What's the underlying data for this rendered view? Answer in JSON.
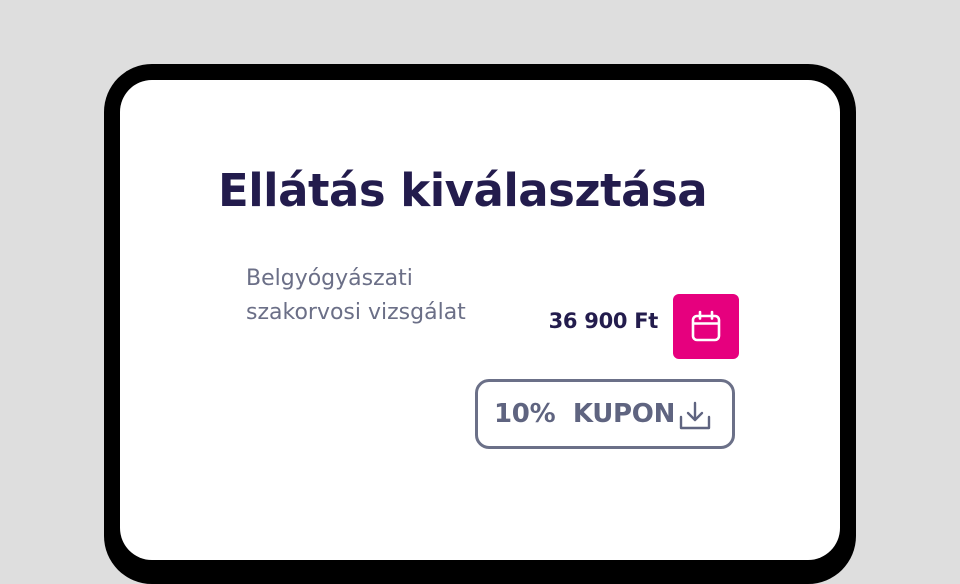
{
  "page": {
    "title": "Ellátás kiválasztása"
  },
  "service": {
    "name_line1": "Belgyógyászati",
    "name_line2": "szakorvosi vizsgálat",
    "price": "36 900 Ft"
  },
  "coupon": {
    "label": "10%  KUPON"
  },
  "icons": {
    "calendar": "calendar-icon",
    "download": "download-icon"
  },
  "colors": {
    "title": "#231c4d",
    "accent": "#e6007e",
    "muted_text": "#6b6f87",
    "coupon_border": "#6b7088",
    "frame": "#000000",
    "background": "#dedede"
  }
}
